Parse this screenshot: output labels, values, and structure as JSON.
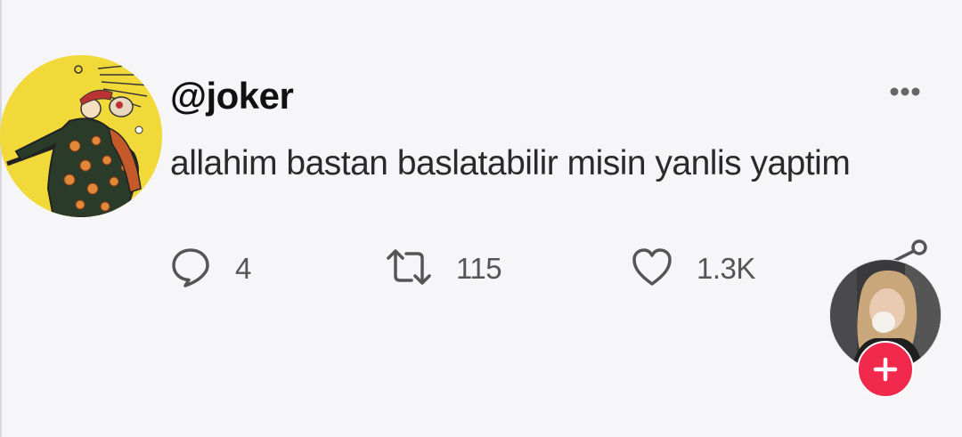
{
  "post": {
    "handle": "@joker",
    "text": "allahim bastan baslatabilir misin yanlis yaptim",
    "replies": "4",
    "reposts": "115",
    "likes": "1.3K"
  },
  "icons": {
    "avatar": "tarot-fool-avatar",
    "more": "more-dots-icon",
    "reply": "comment-bubble-icon",
    "repost": "retweet-icon",
    "like": "heart-icon",
    "share": "share-icon",
    "floating_avatar": "user-avatar",
    "plus": "plus-icon"
  },
  "colors": {
    "background": "#f6f6f8",
    "avatar_bg": "#f2d93a",
    "plus_button": "#f0294d"
  }
}
